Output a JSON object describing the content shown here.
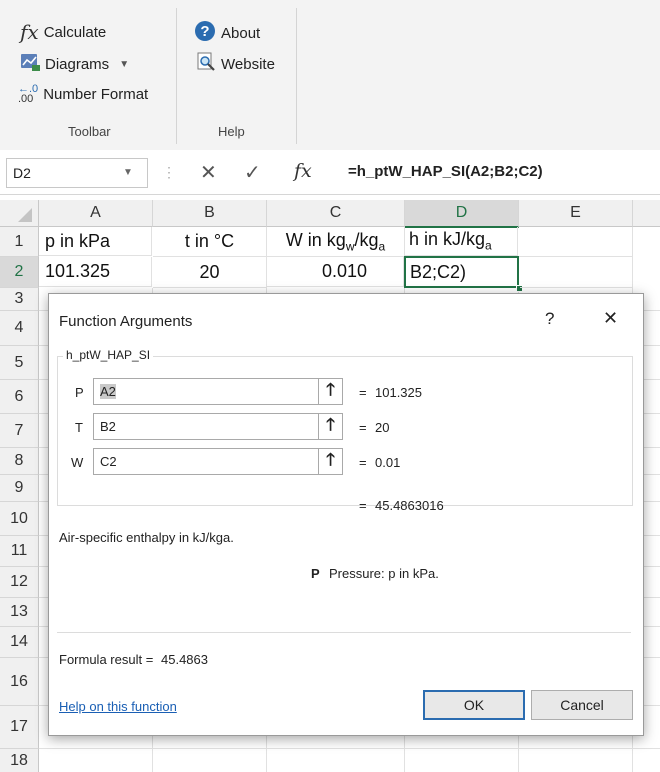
{
  "ribbon": {
    "calculate_label": "Calculate",
    "diagrams_label": "Diagrams",
    "number_format_label": "Number Format",
    "toolbar_group_label": "Toolbar",
    "about_label": "About",
    "website_label": "Website",
    "help_group_label": "Help"
  },
  "formula_bar": {
    "name_box": "D2",
    "fx_symbol": "fx",
    "formula": "=h_ptW_HAP_SI(A2;B2;C2)"
  },
  "grid": {
    "columns": [
      "A",
      "B",
      "C",
      "D",
      "E"
    ],
    "rows": [
      "1",
      "2",
      "3",
      "4",
      "5",
      "6",
      "7",
      "8",
      "9",
      "10",
      "11",
      "12",
      "13",
      "14",
      "16",
      "17",
      "18"
    ],
    "header_row": {
      "a": "p in kPa",
      "b": "t in °C",
      "c": "W in kg",
      "c_sub1": "w",
      "c_mid": "/kg",
      "c_sub2": "a",
      "d": "h in kJ/kg",
      "d_sub": "a"
    },
    "data_row": {
      "a": "101.325",
      "b": "20",
      "c": "0.010",
      "d": "B2;C2)"
    }
  },
  "dialog": {
    "title": "Function Arguments",
    "help_glyph": "?",
    "close_glyph": "✕",
    "function_name": "h_ptW_HAP_SI",
    "args": [
      {
        "name": "P",
        "value": "A2",
        "result": "101.325"
      },
      {
        "name": "T",
        "value": "B2",
        "result": "20"
      },
      {
        "name": "W",
        "value": "C2",
        "result": "0.01"
      }
    ],
    "equals": "=",
    "function_result": "45.4863016",
    "description": "Air-specific enthalpy in kJ/kga.",
    "param_name": "P",
    "param_desc": "Pressure: p in kPa.",
    "formula_result_label": "Formula result =",
    "formula_result_value": "45.4863",
    "help_link": "Help on this function",
    "ok_label": "OK",
    "cancel_label": "Cancel"
  }
}
